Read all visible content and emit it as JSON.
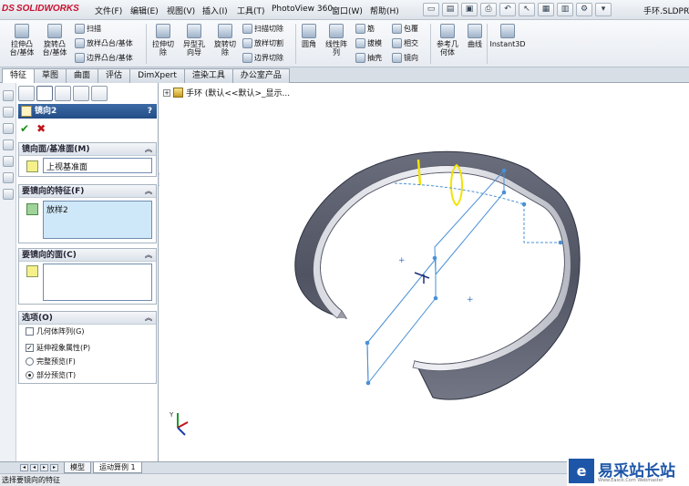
{
  "app": {
    "logo_text": "SOLIDWORKS",
    "logo_prefix": "DS",
    "document_title": "手环.SLDPRT",
    "menu": [
      "文件(F)",
      "编辑(E)",
      "视图(V)",
      "插入(I)",
      "工具(T)",
      "PhotoView 360",
      "窗口(W)",
      "帮助(H)"
    ]
  },
  "ribbon": {
    "extrude_boss": "拉伸凸\n台/基体",
    "revolve_boss": "旋转凸\n台/基体",
    "sweep": "扫描",
    "loft_boss": "放样凸台/基体",
    "boundary_boss": "边界凸台/基体",
    "extrude_cut": "拉伸切\n除",
    "hole_wizard": "异型孔\n向导",
    "revolve_cut": "旋转切\n除",
    "swept_cut": "扫描切除",
    "lofted_cut": "放样切割",
    "boundary_cut": "边界切除",
    "fillet": "圆角",
    "linear_pattern": "线性阵\n列",
    "rib": "筋",
    "draft": "拔模",
    "shell": "抽壳",
    "wrap": "包覆",
    "intersect": "相交",
    "mirror": "镜向",
    "reference_geometry": "参考几\n何体",
    "curves": "曲线",
    "instant3d": "Instant3D"
  },
  "tabs": [
    "特征",
    "草图",
    "曲面",
    "评估",
    "DimXpert",
    "渲染工具",
    "办公室产品"
  ],
  "active_tab": "特征",
  "property_manager": {
    "title": "镜向2",
    "help": "?",
    "ok_symbol": "✔",
    "cancel_symbol": "✖",
    "mirror_plane": {
      "header": "镜向面/基准面(M)",
      "value": "上视基准面"
    },
    "features_to_mirror": {
      "header": "要镜向的特征(F)",
      "items": [
        "放样2"
      ]
    },
    "faces_to_mirror": {
      "header": "要镜向的面(C)"
    },
    "options": {
      "header": "选项(O)",
      "geometry_pattern": {
        "label": "几何体阵列(G)",
        "checked": false
      },
      "propagate_visual": {
        "label": "延伸视象属性(P)",
        "checked": true
      },
      "full_preview": {
        "label": "完整预览(F)",
        "selected": false
      },
      "partial_preview": {
        "label": "部分预览(T)",
        "selected": true
      }
    }
  },
  "tree": {
    "expand": "+",
    "label": "手环  (默认<<默认>_显示..."
  },
  "bottom_tabs": [
    "模型",
    "运动算例 1"
  ],
  "status": "选择要镜向的特征",
  "watermark": {
    "badge": "e",
    "text": "易采站长站",
    "url": "Www.Easck.Com Webmaster"
  },
  "colors": {
    "header_blue": "#2b5894",
    "ring_dark": "#5b5f6e",
    "ring_light": "#c4c6cf",
    "preview_blue": "#4a90d6",
    "highlight_yellow": "#f2e300"
  }
}
